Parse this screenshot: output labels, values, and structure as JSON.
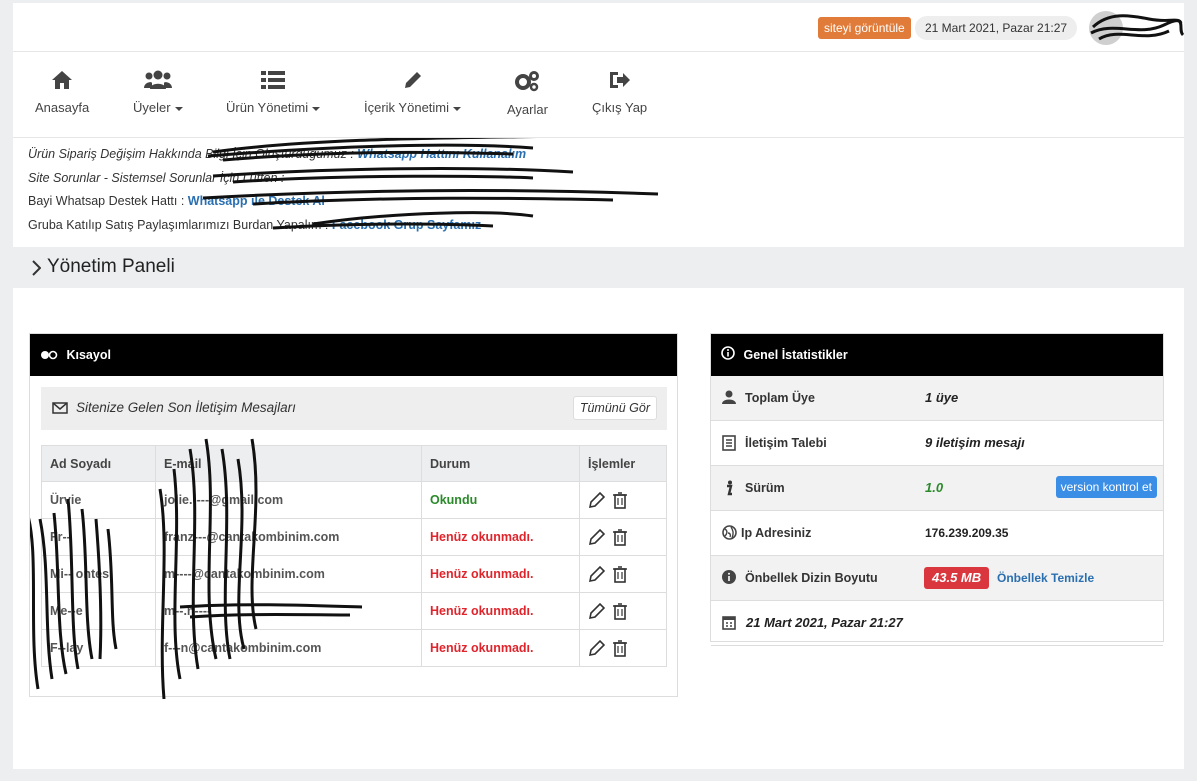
{
  "topbar": {
    "view_site_label": "siteyi görüntüle",
    "datetime": "21 Mart 2021, Pazar 21:27"
  },
  "menu": {
    "items": [
      {
        "label": "Anasayfa",
        "icon": "home-icon"
      },
      {
        "label": "Üyeler",
        "icon": "users-icon",
        "dropdown": true
      },
      {
        "label": "Ürün Yönetimi",
        "icon": "list-icon",
        "dropdown": true
      },
      {
        "label": "İçerik Yönetimi",
        "icon": "pencil-icon",
        "dropdown": true
      },
      {
        "label": "Ayarlar",
        "icon": "gears-icon"
      },
      {
        "label": "Çıkış Yap",
        "icon": "sign-out-icon"
      }
    ]
  },
  "notices": [
    {
      "text": "Ürün Sipariş Değişim Hakkında Bilgi İçin Oluşturduğumuz : ",
      "link": "Whatsapp Hattını Kullanalım"
    },
    {
      "text": "Site Sorunlar - Sistemsel Sorunlar İçin Lütfen : ",
      "link": ""
    },
    {
      "text": "Bayi Whatsap Destek Hattı : ",
      "link": "Whatsapp ile Destek Al"
    },
    {
      "text": "Gruba Katılıp Satış Paylaşımlarımızı Burdan Yapalım : ",
      "link": "Facebook Grup Sayfamız"
    }
  ],
  "breadcrumb": {
    "title": "Yönetim Paneli"
  },
  "shortcut_panel": {
    "title": "Kısayol",
    "messages_title": "Sitenize Gelen Son İletişim Mesajları",
    "view_all": "Tümünü Gör",
    "columns": [
      "Ad Soyadı",
      "E-mail",
      "Durum",
      "İşlemler"
    ],
    "rows": [
      {
        "name": "Ürvie",
        "email": "jolie.----@gmail.com",
        "status": "Okundu",
        "read": true
      },
      {
        "name": "Fr--",
        "email": "franz---@cantakombinim.com",
        "status": "Henüz okunmadı.",
        "read": false
      },
      {
        "name": "Mi-- ontes",
        "email": "m----@cantakombinim.com",
        "status": "Henüz okunmadı.",
        "read": false
      },
      {
        "name": "Me--e",
        "email": "m--.n----",
        "status": "Henüz okunmadı.",
        "read": false
      },
      {
        "name": "F--lay",
        "email": "f---n@cantakombinim.com",
        "status": "Henüz okunmadı.",
        "read": false
      }
    ]
  },
  "stats_panel": {
    "title": "Genel İstatistikler",
    "total_members_label": "Toplam Üye",
    "total_members_value": "1 üye",
    "contact_label": "İletişim Talebi",
    "contact_value": "9 iletişim mesajı",
    "version_label": "Sürüm",
    "version_value": "1.0",
    "version_button": "version kontrol et",
    "ip_label": "Ip Adresiniz",
    "ip_value": "176.239.209.35",
    "cache_label": "Önbellek Dizin Boyutu",
    "cache_value": "43.5 MB",
    "cache_clear": "Önbellek Temizle",
    "date_value": "21 Mart 2021, Pazar 21:27"
  }
}
